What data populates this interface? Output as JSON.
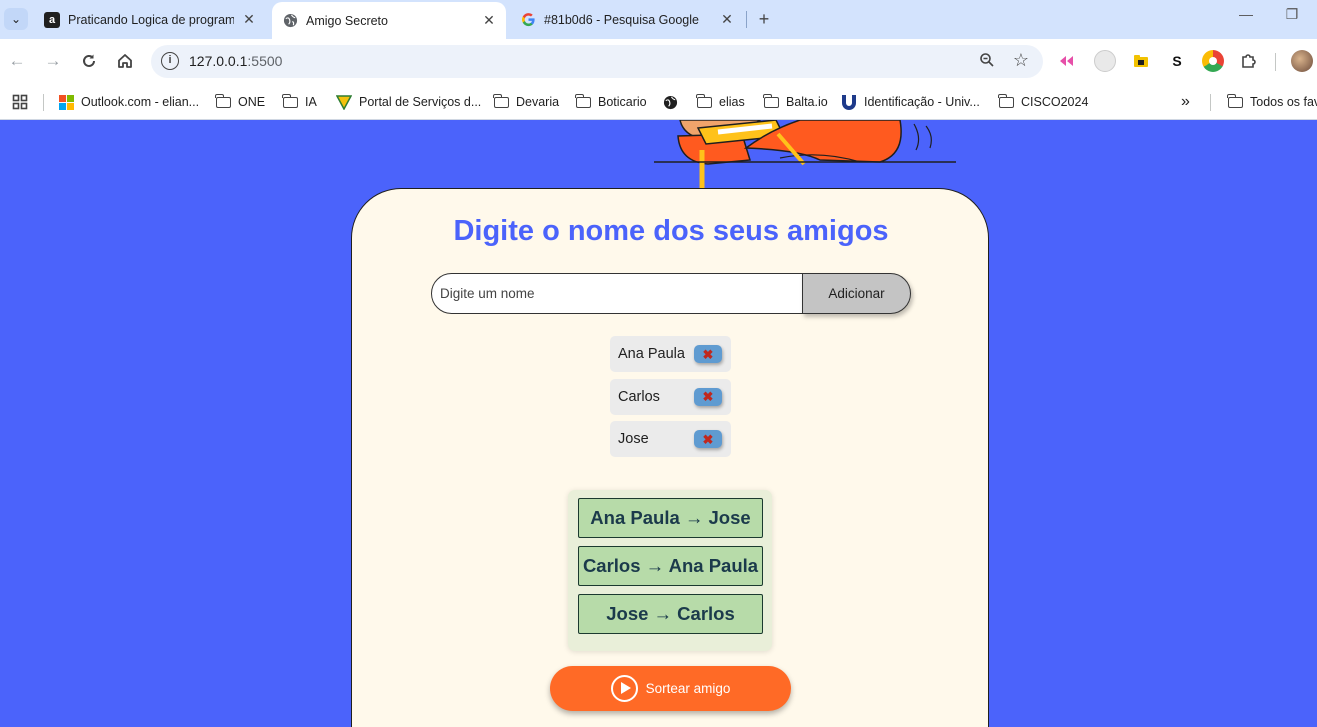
{
  "browser": {
    "tabs": [
      {
        "title": "Praticando Logica de programa",
        "favicon": "a",
        "active": false
      },
      {
        "title": "Amigo Secreto",
        "favicon": "globe",
        "active": true
      },
      {
        "title": "#81b0d6 - Pesquisa Google",
        "favicon": "G",
        "active": false
      }
    ],
    "url_host": "127.0.0.1",
    "url_port": ":5500",
    "bookmarks": [
      {
        "label": "Outlook.com - elian...",
        "icon": "microsoft-icon"
      },
      {
        "label": "ONE",
        "icon": "folder-icon"
      },
      {
        "label": "IA",
        "icon": "folder-icon"
      },
      {
        "label": "Portal de Serviços d...",
        "icon": "portal-icon"
      },
      {
        "label": "Devaria",
        "icon": "folder-icon"
      },
      {
        "label": "Boticario",
        "icon": "folder-icon"
      },
      {
        "label": "elias",
        "icon": "folder-icon"
      },
      {
        "label": "Balta.io",
        "icon": "folder-icon"
      },
      {
        "label": "Identificação - Univ...",
        "icon": "university-icon"
      },
      {
        "label": "CISCO2024",
        "icon": "folder-icon"
      }
    ],
    "bookmarks_overflow": "»",
    "all_bookmarks": "Todos os fav"
  },
  "app": {
    "title": "Digite o nome dos seus amigos",
    "input_placeholder": "Digite um nome",
    "input_value": "",
    "add_button": "Adicionar",
    "friends": [
      "Ana Paula",
      "Carlos",
      "Jose"
    ],
    "results": [
      "Ana Paula → Jose",
      "Carlos → Ana Paula",
      "Jose → Carlos"
    ],
    "draw_button": "Sortear amigo"
  },
  "colors": {
    "background": "#4b63fb",
    "card": "#fff9eb",
    "title": "#4b63fb",
    "draw_button": "#ff6a26",
    "result_item": "#b7dba9"
  }
}
